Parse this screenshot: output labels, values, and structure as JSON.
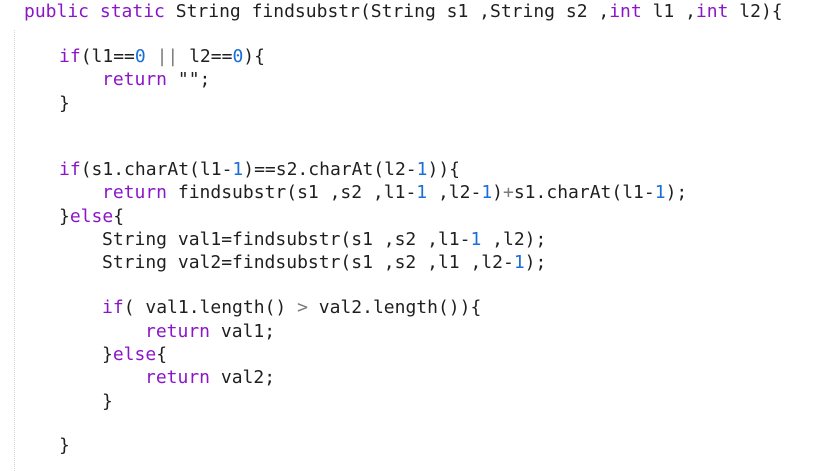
{
  "code": {
    "lines": [
      {
        "indent": 0,
        "segments": [
          {
            "kind": "kw",
            "text": "public static"
          },
          {
            "kind": "txt",
            "text": " String findsubstr(String s1 ,String s2 ,"
          },
          {
            "kind": "kw",
            "text": "int"
          },
          {
            "kind": "txt",
            "text": " l1 ,"
          },
          {
            "kind": "kw",
            "text": "int"
          },
          {
            "kind": "txt",
            "text": " l2){"
          }
        ]
      },
      {
        "indent": 1,
        "segments": [
          {
            "kind": "kw",
            "text": "if"
          },
          {
            "kind": "txt",
            "text": "(l1=="
          },
          {
            "kind": "num",
            "text": "0"
          },
          {
            "kind": "txt",
            "text": " "
          },
          {
            "kind": "op",
            "text": "||"
          },
          {
            "kind": "txt",
            "text": " l2=="
          },
          {
            "kind": "num",
            "text": "0"
          },
          {
            "kind": "txt",
            "text": "){"
          }
        ]
      },
      {
        "indent": 2,
        "segments": [
          {
            "kind": "kw",
            "text": "return"
          },
          {
            "kind": "txt",
            "text": " \"\";"
          }
        ]
      },
      {
        "indent": 1,
        "segments": [
          {
            "kind": "txt",
            "text": "}"
          }
        ]
      },
      {
        "indent": 1,
        "segments": [
          {
            "kind": "kw",
            "text": "if"
          },
          {
            "kind": "txt",
            "text": "(s1.charAt(l1-"
          },
          {
            "kind": "num",
            "text": "1"
          },
          {
            "kind": "txt",
            "text": ")==s2.charAt(l2-"
          },
          {
            "kind": "num",
            "text": "1"
          },
          {
            "kind": "txt",
            "text": ")){"
          }
        ]
      },
      {
        "indent": 2,
        "segments": [
          {
            "kind": "kw",
            "text": "return"
          },
          {
            "kind": "txt",
            "text": " findsubstr(s1 ,s2 ,l1-"
          },
          {
            "kind": "num",
            "text": "1"
          },
          {
            "kind": "txt",
            "text": " ,l2-"
          },
          {
            "kind": "num",
            "text": "1"
          },
          {
            "kind": "txt",
            "text": ")"
          },
          {
            "kind": "op",
            "text": "+"
          },
          {
            "kind": "txt",
            "text": "s1.charAt(l1-"
          },
          {
            "kind": "num",
            "text": "1"
          },
          {
            "kind": "txt",
            "text": ");"
          }
        ]
      },
      {
        "indent": 1,
        "segments": [
          {
            "kind": "txt",
            "text": "}"
          },
          {
            "kind": "kw",
            "text": "else"
          },
          {
            "kind": "txt",
            "text": "{"
          }
        ]
      },
      {
        "indent": 2,
        "segments": [
          {
            "kind": "txt",
            "text": "String val1=findsubstr(s1 ,s2 ,l1-"
          },
          {
            "kind": "num",
            "text": "1"
          },
          {
            "kind": "txt",
            "text": " ,l2);"
          }
        ]
      },
      {
        "indent": 2,
        "segments": [
          {
            "kind": "txt",
            "text": "String val2=findsubstr(s1 ,s2 ,l1 ,l2-"
          },
          {
            "kind": "num",
            "text": "1"
          },
          {
            "kind": "txt",
            "text": ");"
          }
        ]
      },
      {
        "indent": 2,
        "segments": [
          {
            "kind": "kw",
            "text": "if"
          },
          {
            "kind": "txt",
            "text": "( val1.length() "
          },
          {
            "kind": "op",
            "text": ">"
          },
          {
            "kind": "txt",
            "text": " val2.length()){"
          }
        ]
      },
      {
        "indent": 3,
        "segments": [
          {
            "kind": "kw",
            "text": "return"
          },
          {
            "kind": "txt",
            "text": " val1;"
          }
        ]
      },
      {
        "indent": 2,
        "segments": [
          {
            "kind": "txt",
            "text": "}"
          },
          {
            "kind": "kw",
            "text": "else"
          },
          {
            "kind": "txt",
            "text": "{"
          }
        ]
      },
      {
        "indent": 3,
        "segments": [
          {
            "kind": "kw",
            "text": "return"
          },
          {
            "kind": "txt",
            "text": " val2;"
          }
        ]
      },
      {
        "indent": 2,
        "segments": [
          {
            "kind": "txt",
            "text": "}"
          }
        ]
      },
      {
        "indent": 1,
        "segments": [
          {
            "kind": "txt",
            "text": "}"
          }
        ]
      }
    ]
  }
}
